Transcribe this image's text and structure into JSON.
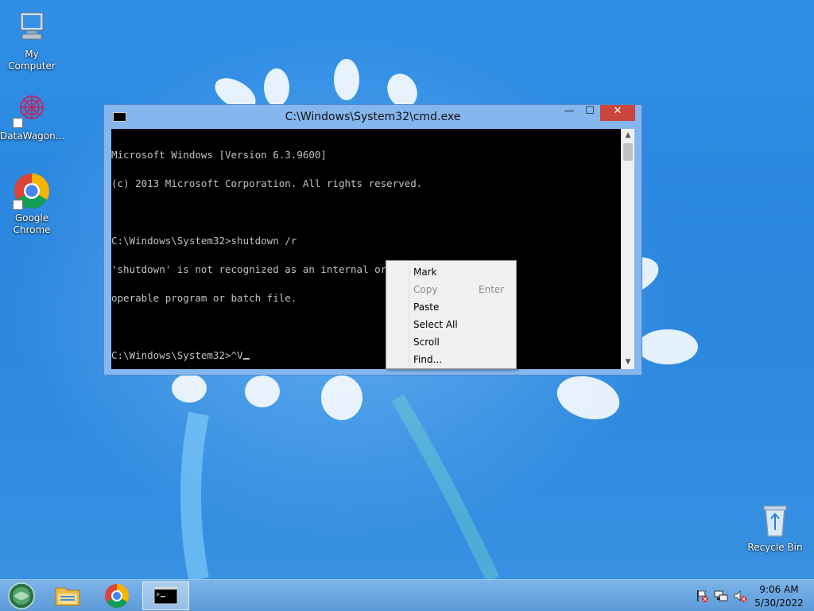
{
  "desktop": {
    "icons": [
      {
        "label": "My Computer",
        "icon": "computer-icon"
      },
      {
        "label": "DataWagon...",
        "icon": "datawagon-icon"
      },
      {
        "label": "Google Chrome",
        "icon": "chrome-icon"
      },
      {
        "label": "Recycle Bin",
        "icon": "recycle-bin-icon"
      }
    ]
  },
  "window": {
    "title": "C:\\Windows\\System32\\cmd.exe",
    "buttons": {
      "minimize": "—",
      "maximize": "☐",
      "close": "✕"
    },
    "console_lines": [
      "Microsoft Windows [Version 6.3.9600]",
      "(c) 2013 Microsoft Corporation. All rights reserved.",
      "",
      "C:\\Windows\\System32>shutdown /r",
      "'shutdown' is not recognized as an internal or external command,",
      "operable program or batch file.",
      "",
      "C:\\Windows\\System32>^V"
    ]
  },
  "context_menu": {
    "items": [
      {
        "label": "Mark",
        "shortcut": "",
        "enabled": true
      },
      {
        "label": "Copy",
        "shortcut": "Enter",
        "enabled": false
      },
      {
        "label": "Paste",
        "shortcut": "",
        "enabled": true
      },
      {
        "label": "Select All",
        "shortcut": "",
        "enabled": true
      },
      {
        "label": "Scroll",
        "shortcut": "",
        "enabled": true
      },
      {
        "label": "Find...",
        "shortcut": "",
        "enabled": true
      }
    ]
  },
  "taskbar": {
    "clock_time": "9:06 AM",
    "clock_date": "5/30/2022",
    "tray_icons": [
      "action-center-flag-icon",
      "network-icon",
      "volume-muted-icon"
    ]
  },
  "colors": {
    "desktop_bg": "#2a86de",
    "console_bg": "#000000",
    "console_text": "#c0c0c0",
    "close_button": "#c9463d",
    "window_frame": "#85b6ee"
  }
}
